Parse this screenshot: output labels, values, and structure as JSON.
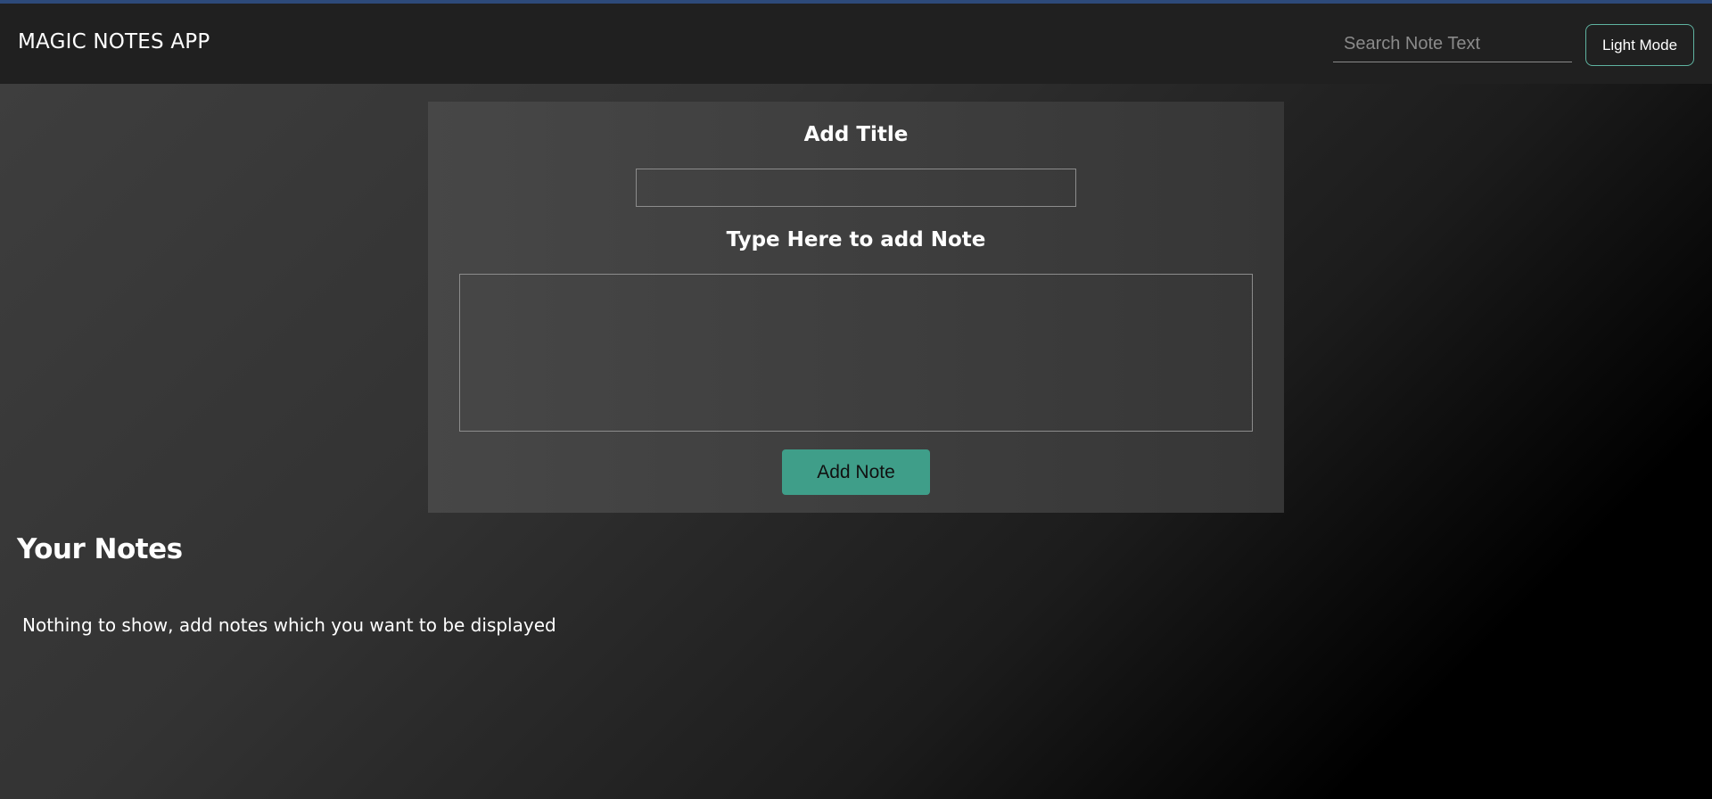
{
  "navbar": {
    "brand": "MAGIC NOTES APP",
    "search_placeholder": "Search Note Text",
    "mode_toggle_label": "Light Mode"
  },
  "form": {
    "title_heading": "Add Title",
    "title_value": "",
    "note_heading": "Type Here to add Note",
    "note_value": "",
    "add_button_label": "Add Note"
  },
  "notes": {
    "heading": "Your Notes",
    "empty_message": "Nothing to show, add notes which you want to be displayed"
  },
  "colors": {
    "accent": "#3f9e89",
    "mode_button_border": "#5fb3a0",
    "navbar_bg": "#202020",
    "top_accent": "#2d4a7a"
  }
}
